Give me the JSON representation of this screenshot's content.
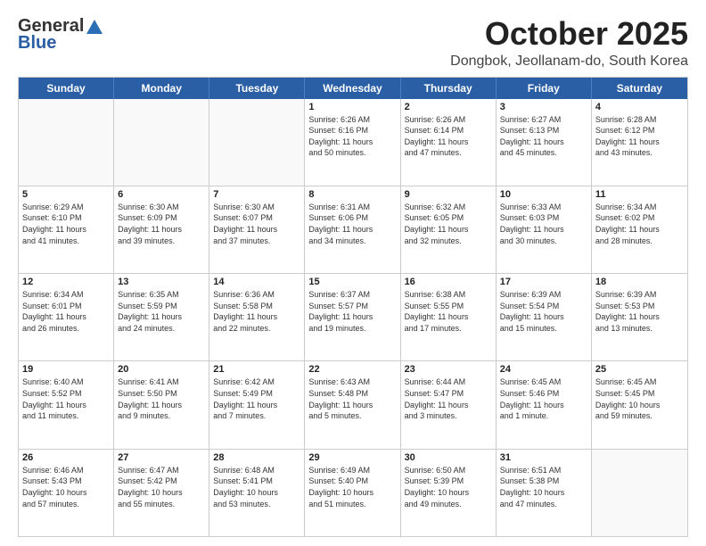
{
  "logo": {
    "line1": "General",
    "line2": "Blue"
  },
  "header": {
    "month": "October 2025",
    "location": "Dongbok, Jeollanam-do, South Korea"
  },
  "weekdays": [
    "Sunday",
    "Monday",
    "Tuesday",
    "Wednesday",
    "Thursday",
    "Friday",
    "Saturday"
  ],
  "rows": [
    [
      {
        "day": "",
        "text": ""
      },
      {
        "day": "",
        "text": ""
      },
      {
        "day": "",
        "text": ""
      },
      {
        "day": "1",
        "text": "Sunrise: 6:26 AM\nSunset: 6:16 PM\nDaylight: 11 hours\nand 50 minutes."
      },
      {
        "day": "2",
        "text": "Sunrise: 6:26 AM\nSunset: 6:14 PM\nDaylight: 11 hours\nand 47 minutes."
      },
      {
        "day": "3",
        "text": "Sunrise: 6:27 AM\nSunset: 6:13 PM\nDaylight: 11 hours\nand 45 minutes."
      },
      {
        "day": "4",
        "text": "Sunrise: 6:28 AM\nSunset: 6:12 PM\nDaylight: 11 hours\nand 43 minutes."
      }
    ],
    [
      {
        "day": "5",
        "text": "Sunrise: 6:29 AM\nSunset: 6:10 PM\nDaylight: 11 hours\nand 41 minutes."
      },
      {
        "day": "6",
        "text": "Sunrise: 6:30 AM\nSunset: 6:09 PM\nDaylight: 11 hours\nand 39 minutes."
      },
      {
        "day": "7",
        "text": "Sunrise: 6:30 AM\nSunset: 6:07 PM\nDaylight: 11 hours\nand 37 minutes."
      },
      {
        "day": "8",
        "text": "Sunrise: 6:31 AM\nSunset: 6:06 PM\nDaylight: 11 hours\nand 34 minutes."
      },
      {
        "day": "9",
        "text": "Sunrise: 6:32 AM\nSunset: 6:05 PM\nDaylight: 11 hours\nand 32 minutes."
      },
      {
        "day": "10",
        "text": "Sunrise: 6:33 AM\nSunset: 6:03 PM\nDaylight: 11 hours\nand 30 minutes."
      },
      {
        "day": "11",
        "text": "Sunrise: 6:34 AM\nSunset: 6:02 PM\nDaylight: 11 hours\nand 28 minutes."
      }
    ],
    [
      {
        "day": "12",
        "text": "Sunrise: 6:34 AM\nSunset: 6:01 PM\nDaylight: 11 hours\nand 26 minutes."
      },
      {
        "day": "13",
        "text": "Sunrise: 6:35 AM\nSunset: 5:59 PM\nDaylight: 11 hours\nand 24 minutes."
      },
      {
        "day": "14",
        "text": "Sunrise: 6:36 AM\nSunset: 5:58 PM\nDaylight: 11 hours\nand 22 minutes."
      },
      {
        "day": "15",
        "text": "Sunrise: 6:37 AM\nSunset: 5:57 PM\nDaylight: 11 hours\nand 19 minutes."
      },
      {
        "day": "16",
        "text": "Sunrise: 6:38 AM\nSunset: 5:55 PM\nDaylight: 11 hours\nand 17 minutes."
      },
      {
        "day": "17",
        "text": "Sunrise: 6:39 AM\nSunset: 5:54 PM\nDaylight: 11 hours\nand 15 minutes."
      },
      {
        "day": "18",
        "text": "Sunrise: 6:39 AM\nSunset: 5:53 PM\nDaylight: 11 hours\nand 13 minutes."
      }
    ],
    [
      {
        "day": "19",
        "text": "Sunrise: 6:40 AM\nSunset: 5:52 PM\nDaylight: 11 hours\nand 11 minutes."
      },
      {
        "day": "20",
        "text": "Sunrise: 6:41 AM\nSunset: 5:50 PM\nDaylight: 11 hours\nand 9 minutes."
      },
      {
        "day": "21",
        "text": "Sunrise: 6:42 AM\nSunset: 5:49 PM\nDaylight: 11 hours\nand 7 minutes."
      },
      {
        "day": "22",
        "text": "Sunrise: 6:43 AM\nSunset: 5:48 PM\nDaylight: 11 hours\nand 5 minutes."
      },
      {
        "day": "23",
        "text": "Sunrise: 6:44 AM\nSunset: 5:47 PM\nDaylight: 11 hours\nand 3 minutes."
      },
      {
        "day": "24",
        "text": "Sunrise: 6:45 AM\nSunset: 5:46 PM\nDaylight: 11 hours\nand 1 minute."
      },
      {
        "day": "25",
        "text": "Sunrise: 6:45 AM\nSunset: 5:45 PM\nDaylight: 10 hours\nand 59 minutes."
      }
    ],
    [
      {
        "day": "26",
        "text": "Sunrise: 6:46 AM\nSunset: 5:43 PM\nDaylight: 10 hours\nand 57 minutes."
      },
      {
        "day": "27",
        "text": "Sunrise: 6:47 AM\nSunset: 5:42 PM\nDaylight: 10 hours\nand 55 minutes."
      },
      {
        "day": "28",
        "text": "Sunrise: 6:48 AM\nSunset: 5:41 PM\nDaylight: 10 hours\nand 53 minutes."
      },
      {
        "day": "29",
        "text": "Sunrise: 6:49 AM\nSunset: 5:40 PM\nDaylight: 10 hours\nand 51 minutes."
      },
      {
        "day": "30",
        "text": "Sunrise: 6:50 AM\nSunset: 5:39 PM\nDaylight: 10 hours\nand 49 minutes."
      },
      {
        "day": "31",
        "text": "Sunrise: 6:51 AM\nSunset: 5:38 PM\nDaylight: 10 hours\nand 47 minutes."
      },
      {
        "day": "",
        "text": ""
      }
    ]
  ]
}
